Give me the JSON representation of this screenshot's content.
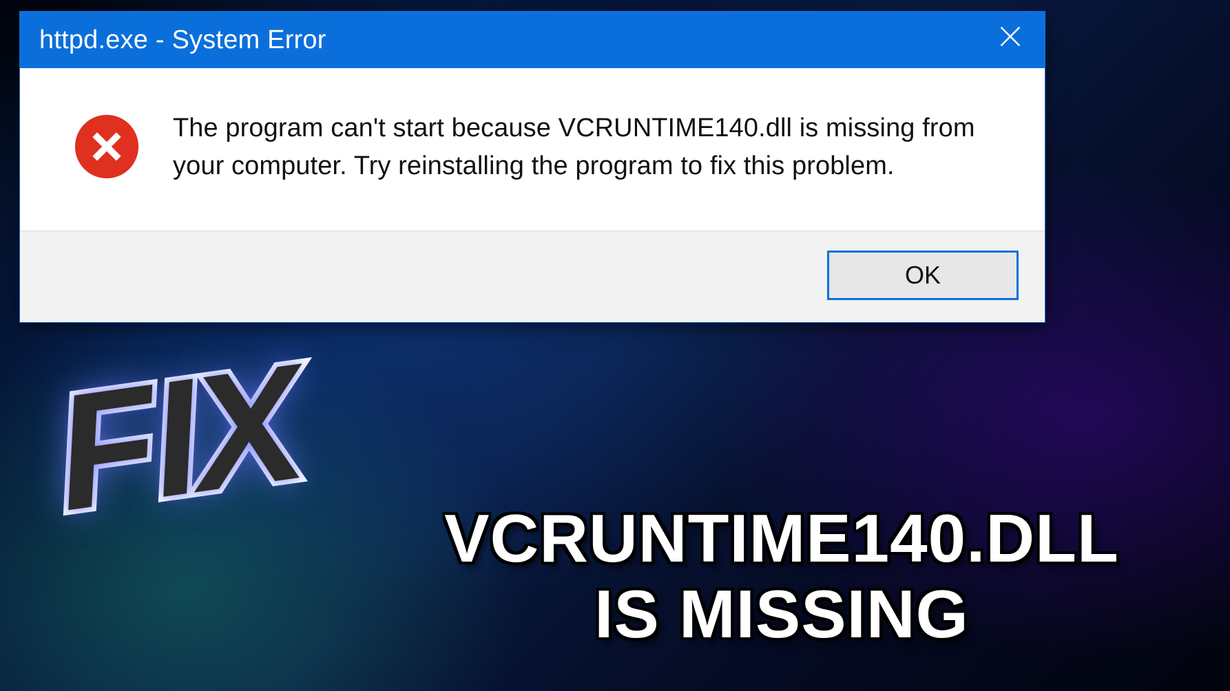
{
  "dialog": {
    "title": "httpd.exe - System Error",
    "message": "The program can't start because VCRUNTIME140.dll is missing from your computer. Try reinstalling the program to fix this problem.",
    "ok_label": "OK"
  },
  "overlay": {
    "fix": "FIX",
    "caption_line1": "VCRUNTIME140.DLL",
    "caption_line2": "IS MISSING"
  },
  "icons": {
    "error": "error-circle-x",
    "close": "close-x"
  },
  "colors": {
    "titlebar": "#0b6fdb",
    "error_red": "#e03020",
    "button_border": "#0b6fdb"
  }
}
